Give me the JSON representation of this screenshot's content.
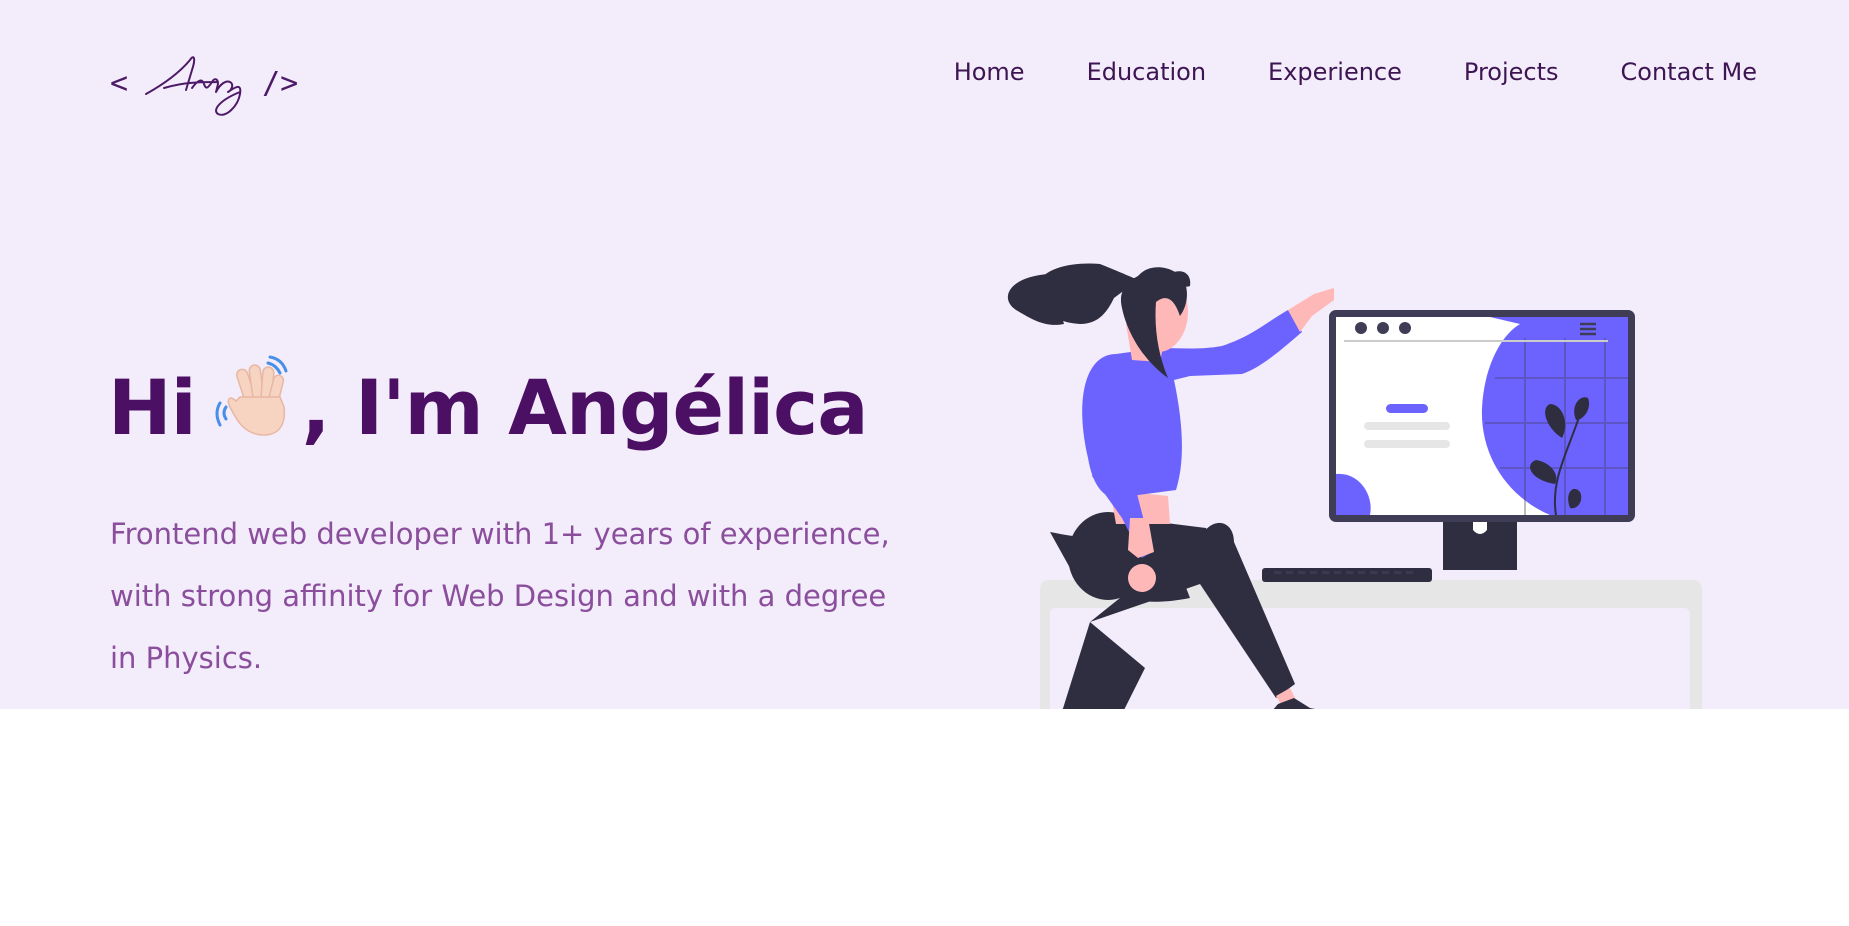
{
  "header": {
    "logo": {
      "open_bracket": "<",
      "signature": "Ang",
      "close_bracket": "/>"
    },
    "nav": [
      {
        "label": "Home"
      },
      {
        "label": "Education"
      },
      {
        "label": "Experience"
      },
      {
        "label": "Projects"
      },
      {
        "label": "Contact Me"
      }
    ]
  },
  "hero": {
    "greeting": "Hi",
    "greeting_icon": "waving-hand-icon",
    "name_line": ", I'm Angélica",
    "description": "Frontend web developer with 1+ years of experience, with strong affinity for Web Design and with a degree in Physics.",
    "illustration": "woman-at-computer-illustration"
  },
  "colors": {
    "hero_background": "#f3ecfb",
    "title": "#4b0f63",
    "description": "#8a4e9c",
    "accent": "#6c63ff",
    "dark": "#2f2e41",
    "page_background": "#ffffff"
  }
}
